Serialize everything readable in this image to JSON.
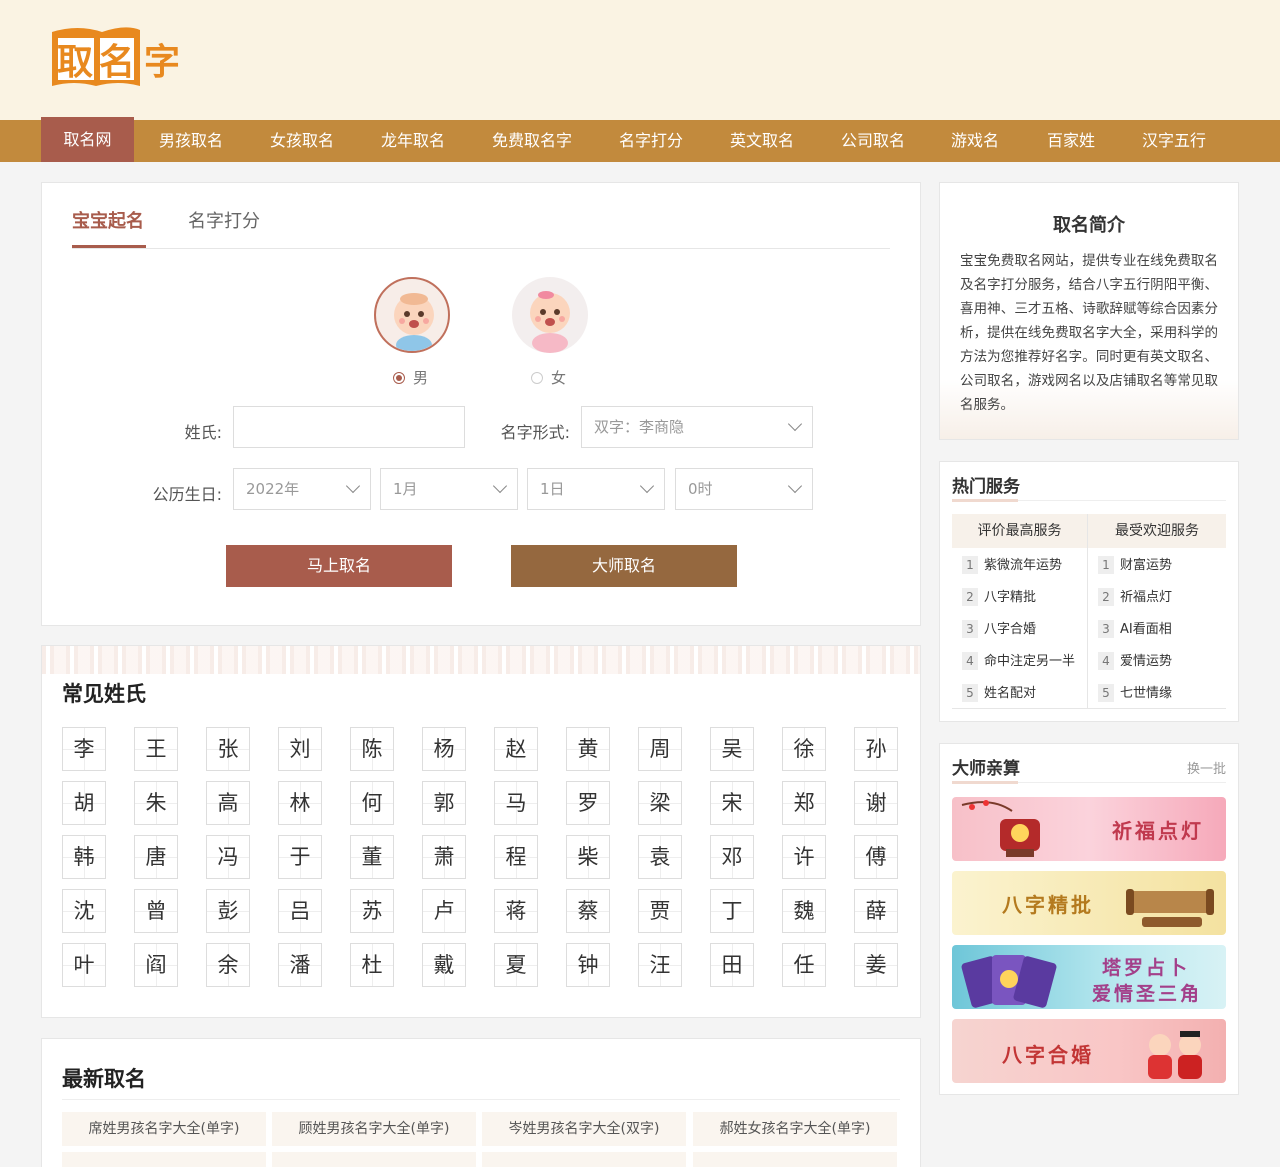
{
  "logo": {
    "text": "取名字"
  },
  "nav": {
    "items": [
      "取名网",
      "男孩取名",
      "女孩取名",
      "龙年取名",
      "免费取名字",
      "名字打分",
      "英文取名",
      "公司取名",
      "游戏名",
      "百家姓",
      "汉字五行"
    ],
    "active": "取名网"
  },
  "form": {
    "tabs": [
      "宝宝起名",
      "名字打分"
    ],
    "gender": {
      "male": "男",
      "female": "女",
      "selected": "男"
    },
    "surname_label": "姓氏:",
    "surname_value": "",
    "name_form_label": "名字形式:",
    "name_form_value": "双字：李商隐",
    "birthday_label": "公历生日:",
    "year": "2022年",
    "month": "1月",
    "day": "1日",
    "hour": "0时",
    "submit_label": "马上取名",
    "master_label": "大师取名"
  },
  "surnames": {
    "title": "常见姓氏",
    "rows": [
      [
        "李",
        "王",
        "张",
        "刘",
        "陈",
        "杨",
        "赵",
        "黄",
        "周",
        "吴",
        "徐",
        "孙"
      ],
      [
        "胡",
        "朱",
        "高",
        "林",
        "何",
        "郭",
        "马",
        "罗",
        "梁",
        "宋",
        "郑",
        "谢"
      ],
      [
        "韩",
        "唐",
        "冯",
        "于",
        "董",
        "萧",
        "程",
        "柴",
        "袁",
        "邓",
        "许",
        "傅"
      ],
      [
        "沈",
        "曾",
        "彭",
        "吕",
        "苏",
        "卢",
        "蒋",
        "蔡",
        "贾",
        "丁",
        "魏",
        "薛"
      ],
      [
        "叶",
        "阎",
        "余",
        "潘",
        "杜",
        "戴",
        "夏",
        "钟",
        "汪",
        "田",
        "任",
        "姜"
      ]
    ]
  },
  "latest": {
    "title": "最新取名",
    "items": [
      "席姓男孩名字大全(单字)",
      "顾姓男孩名字大全(单字)",
      "岑姓男孩名字大全(双字)",
      "郝姓女孩名字大全(单字)"
    ]
  },
  "intro": {
    "title": "取名简介",
    "text": "宝宝免费取名网站，提供专业在线免费取名及名字打分服务，结合八字五行阴阳平衡、喜用神、三才五格、诗歌辞赋等综合因素分析，提供在线免费取名字大全，采用科学的方法为您推荐好名字。同时更有英文取名、公司取名，游戏网名以及店铺取名等常见取名服务。"
  },
  "hot_services": {
    "title": "热门服务",
    "col1_title": "评价最高服务",
    "col2_title": "最受欢迎服务",
    "col1": [
      "紫微流年运势",
      "八字精批",
      "八字合婚",
      "命中注定另一半",
      "姓名配对"
    ],
    "col2": [
      "财富运势",
      "祈福点灯",
      "AI看面相",
      "爱情运势",
      "七世情缘"
    ]
  },
  "master": {
    "title": "大师亲算",
    "more": "换一批",
    "banners": [
      {
        "title": "祈福点灯",
        "bg": "#f9c4cf",
        "color": "#c0394e"
      },
      {
        "title": "八字精批",
        "bg": "#f7eab8",
        "color": "#b47a1e"
      },
      {
        "title": "塔罗占卜",
        "subtitle": "爱情圣三角",
        "bg": "#8fd8e6",
        "color": "#a3408a"
      },
      {
        "title": "八字合婚",
        "bg": "#f6c9c9",
        "color": "#c23535"
      }
    ]
  },
  "colors": {
    "primary": "#a85c4c",
    "nav": "#c28a3d",
    "master_button": "#95683f"
  }
}
